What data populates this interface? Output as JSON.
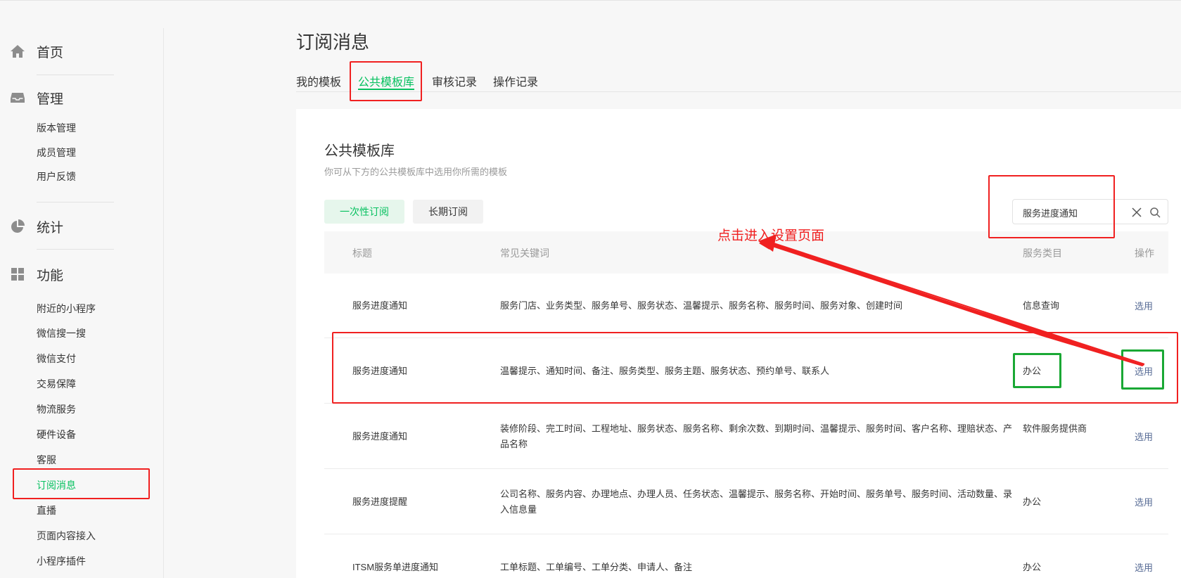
{
  "sidebar": {
    "home_label": "首页",
    "manage_label": "管理",
    "manage_items": [
      "版本管理",
      "成员管理",
      "用户反馈"
    ],
    "stats_label": "统计",
    "features_label": "功能",
    "feature_items": [
      "附近的小程序",
      "微信搜一搜",
      "微信支付",
      "交易保障",
      "物流服务",
      "硬件设备",
      "客服",
      "订阅消息",
      "直播",
      "页面内容接入",
      "小程序插件"
    ],
    "active_item": "订阅消息"
  },
  "header": {
    "title": "订阅消息",
    "tabs": [
      "我的模板",
      "公共模板库",
      "审核记录",
      "操作记录"
    ],
    "active_tab": "公共模板库"
  },
  "card": {
    "title": "公共模板库",
    "description": "你可从下方的公共模板库中选用你所需的模板"
  },
  "filters": {
    "once": "一次性订阅",
    "long": "长期订阅"
  },
  "search": {
    "value": "服务进度通知"
  },
  "table": {
    "columns": [
      "标题",
      "常见关键词",
      "服务类目",
      "操作"
    ],
    "rows": [
      {
        "title": "服务进度通知",
        "keywords": "服务门店、业务类型、服务单号、服务状态、温馨提示、服务名称、服务时间、服务对象、创建时间",
        "category": "信息查询",
        "action": "选用"
      },
      {
        "title": "服务进度通知",
        "keywords": "温馨提示、通知时间、备注、服务类型、服务主题、服务状态、预约单号、联系人",
        "category": "办公",
        "action": "选用"
      },
      {
        "title": "服务进度通知",
        "keywords": "装修阶段、完工时间、工程地址、服务状态、服务名称、剩余次数、到期时间、温馨提示、服务时间、客户名称、理赔状态、产品名称",
        "category": "软件服务提供商",
        "action": "选用"
      },
      {
        "title": "服务进度提醒",
        "keywords": "公司名称、服务内容、办理地点、办理人员、任务状态、温馨提示、服务名称、开始时间、服务单号、服务时间、活动数量、录入信息量",
        "category": "办公",
        "action": "选用"
      },
      {
        "title": "ITSM服务单进度通知",
        "keywords": "工单标题、工单编号、工单分类、申请人、备注",
        "category": "办公",
        "action": "选用"
      }
    ]
  },
  "annotation": {
    "text": "点击进入设置页面",
    "color": "#f02020",
    "highlight_green": "#1aa834"
  },
  "colors": {
    "accent": "#07c160",
    "link": "#576b95"
  }
}
